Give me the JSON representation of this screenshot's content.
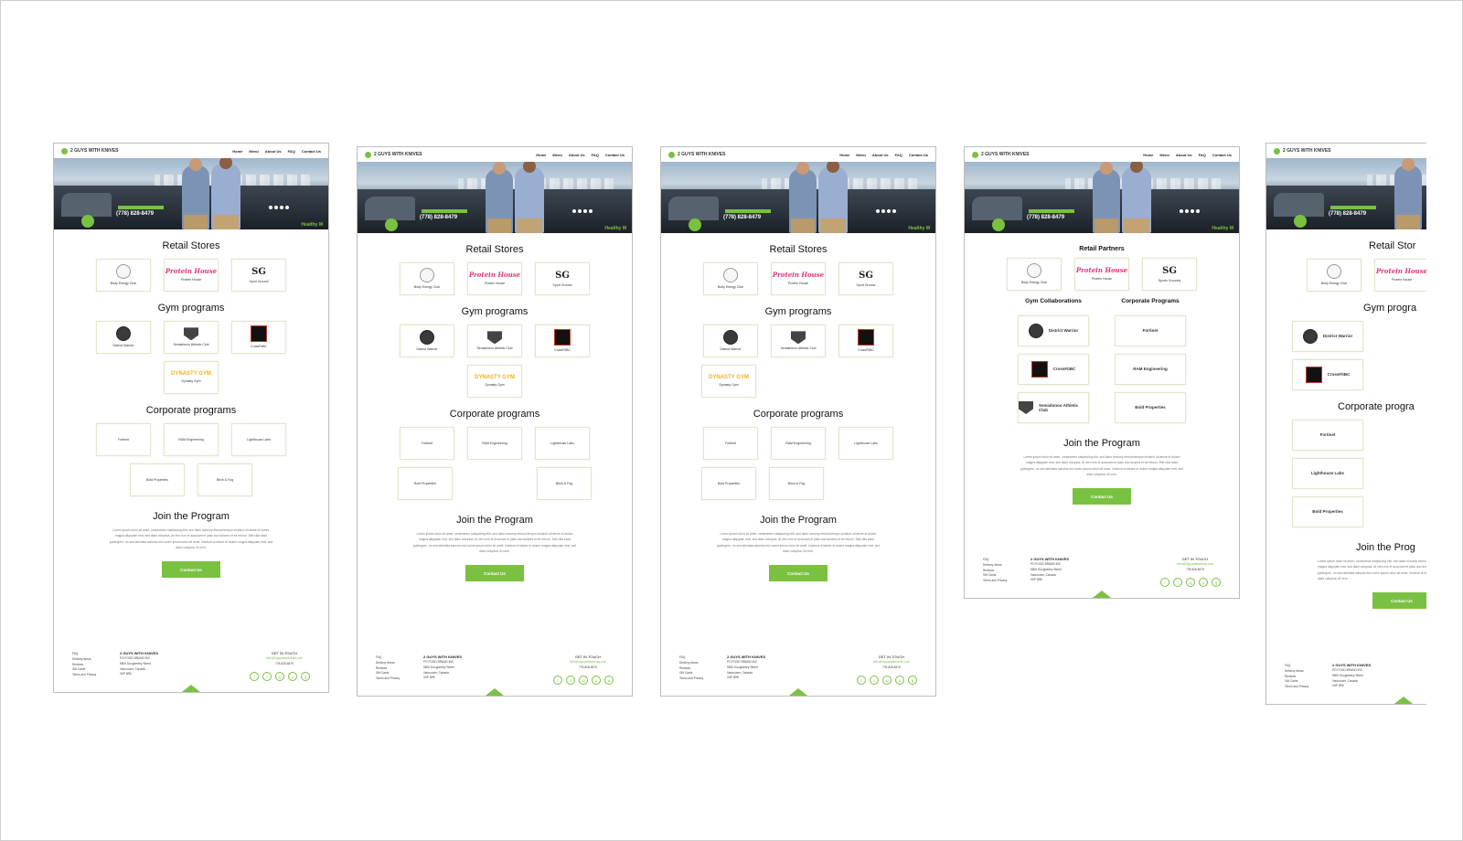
{
  "site": {
    "logo_text": "2 GUYS WITH KNIVES",
    "logo_accent": "KNIVES",
    "nav": [
      "Home",
      "Menu",
      "About Us",
      "FAQ",
      "Contact Us"
    ],
    "hero": {
      "phone": "(778) 828-8479",
      "tagline": "Healthy M"
    }
  },
  "sections": {
    "retail_stores": "Retail Stores",
    "retail_partners": "Retail Partners",
    "gym_programs": "Gym programs",
    "gym_collaborations": "Gym Collaborations",
    "corporate_programs": "Corporate programs",
    "corporate_programs_cap": "Corporate Programs",
    "join": "Join the Program",
    "join_partial": "Join the Prog",
    "retail_partial": "Retail Stor",
    "gym_partial": "Gym progra",
    "corp_partial": "Corporate progra"
  },
  "retail": [
    {
      "label": "Body Energy Club"
    },
    {
      "label": "Protein House",
      "logo": "Protein House"
    },
    {
      "label": "Sport Ground",
      "logo": "SG"
    }
  ],
  "retail_alt_third": "Sports Grounds",
  "gyms": [
    {
      "label": "District Warrior"
    },
    {
      "label": "Semiahmoo Athletic Club"
    },
    {
      "label": "CrossFitBC"
    },
    {
      "label": "Dynasty Gym",
      "logo": "DYNASTY GYM"
    }
  ],
  "corporate": [
    "Fortinet",
    "RAM Engineering",
    "Lighthouse Labs",
    "Bold Properties",
    "Birch & Fog"
  ],
  "lorem": "Lorem ipsum dolor sit amet, consectetur sadipscing elitr, sed diam nonumy eirmod tempor invidunt ut labore et dolore magna aliquyam erat, sed diam voluptua. At vero eos et accusam et justo duo dolores et ea rebum. Stet clita kasd gubergren, no sea takimata sanctus est Lorem ipsum dolor sit amet. Invidunt ut labore et dolore magna aliquyam erat, sed diam voluptua. At vero.",
  "cta": "Contact Us",
  "footer": {
    "links": [
      "FAQ",
      "Delivery Areas",
      "Reviews",
      "Gift Cards",
      "Terms and Privacy"
    ],
    "company_head": "2 GUYS WITH KNIVES",
    "company_lines": [
      "PO FOOD BRAND INC",
      "5500 Doughertey Street",
      "Vancouver, Canada",
      "V6P 8R6"
    ],
    "contact_head": "GET IN TOUCH",
    "email": "hello@2guyswithknives.com",
    "phone": "778-828-8479",
    "socials": [
      "f",
      "t",
      "ig",
      "p",
      "g"
    ]
  }
}
